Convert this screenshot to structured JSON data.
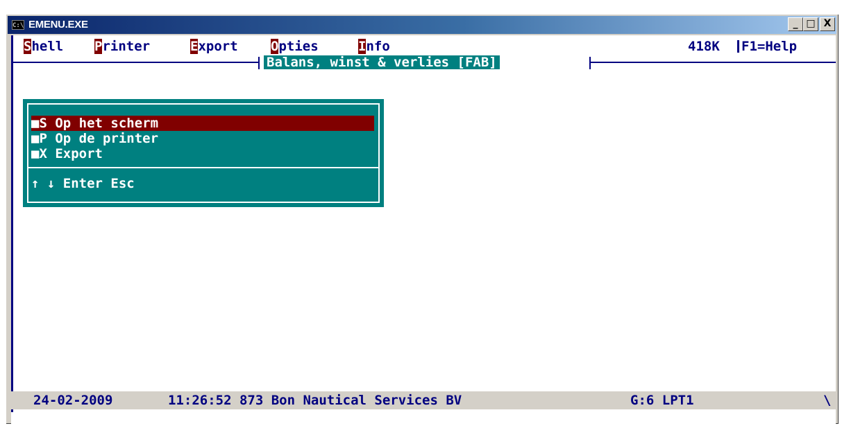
{
  "window": {
    "title": "EMENU.EXE",
    "icon_text": "C:\\",
    "buttons": [
      "_",
      "□",
      "X"
    ]
  },
  "menubar": {
    "items": [
      {
        "hot": "S",
        "rest": "hell"
      },
      {
        "hot": "P",
        "rest": "rinter"
      },
      {
        "hot": "E",
        "rest": "xport"
      },
      {
        "hot": "O",
        "rest": "pties"
      },
      {
        "hot": "I",
        "rest": "nfo"
      }
    ],
    "memory": "418K",
    "help": "F1=Help"
  },
  "screen_title": "Balans, winst & verlies [FAB]",
  "menu": {
    "options": [
      {
        "key": "■S",
        "label": "Op het scherm",
        "selected": true
      },
      {
        "key": "■P",
        "label": "Op de printer",
        "selected": false
      },
      {
        "key": "■X",
        "label": "Export",
        "selected": false
      }
    ],
    "keys_hint": "↑ ↓ Enter Esc"
  },
  "status": {
    "date": "24-02-2009",
    "time_company": "11:26:52 873 Bon Nautical Services BV",
    "printer": "G:6 LPT1",
    "corner": "\\"
  },
  "colors": {
    "menu_bg": "#008080",
    "highlight": "#800000",
    "text": "#000080",
    "status_bg": "#d4d0c8"
  }
}
